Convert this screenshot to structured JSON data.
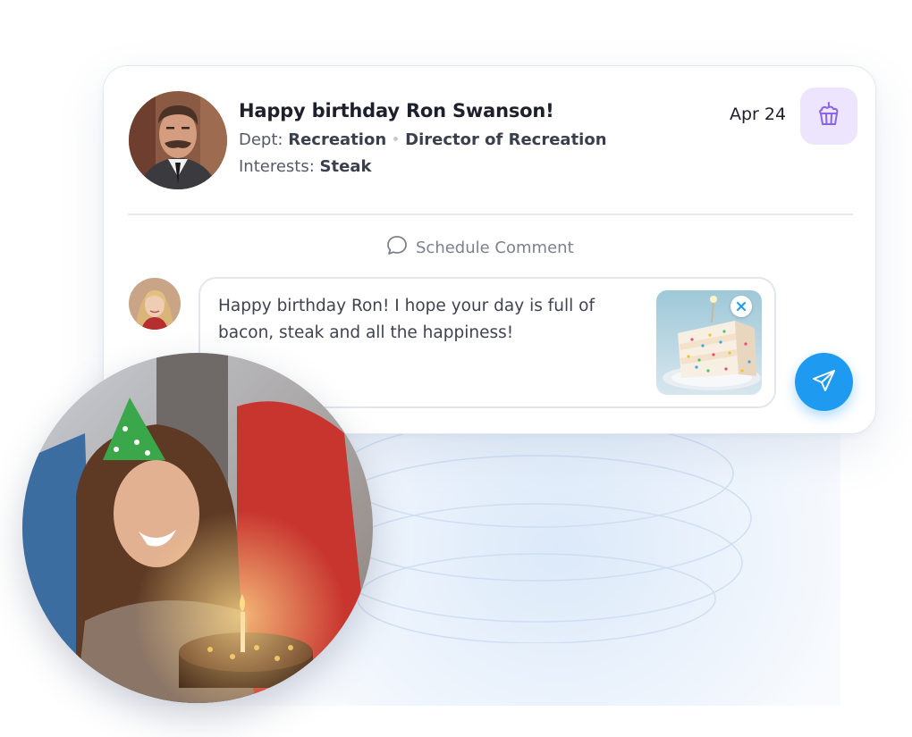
{
  "post": {
    "title": "Happy birthday Ron Swanson!",
    "date": "Apr 24",
    "dept_label": "Dept:",
    "dept_value": "Recreation",
    "role": "Director of Recreation",
    "interests_label": "Interests:",
    "interests_value": "Steak"
  },
  "schedule_comment_label": "Schedule Comment",
  "comment": {
    "text": "Happy birthday Ron! I hope your day is full of bacon, steak and all the happiness!"
  },
  "icons": {
    "badge": "cupcake-icon",
    "schedule": "speech-bubble-icon",
    "send": "paper-plane-icon",
    "remove_attachment": "close-icon"
  },
  "colors": {
    "accent": "#1e9bf0",
    "badge_bg": "#ece5fd",
    "badge_icon": "#8a63e8"
  }
}
